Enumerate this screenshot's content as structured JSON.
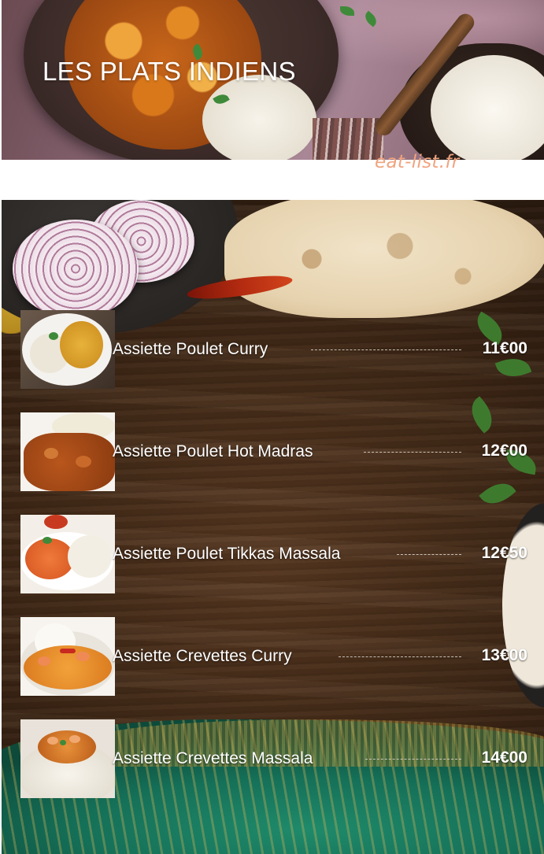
{
  "header": {
    "title": "LES PLATS INDIENS",
    "watermark": "eat-list.fr"
  },
  "menu": {
    "items": [
      {
        "name": "Assiette Poulet Curry",
        "price": "11€00"
      },
      {
        "name": "Assiette Poulet Hot Madras",
        "price": "12€00"
      },
      {
        "name": "Assiette Poulet Tikkas Massala",
        "price": "12€50"
      },
      {
        "name": "Assiette Crevettes Curry",
        "price": "13€00"
      },
      {
        "name": "Assiette Crevettes Massala",
        "price": "14€00"
      }
    ]
  },
  "colors": {
    "title_text": "#ffffff",
    "watermark": "#f1a37e",
    "item_text": "#ffffff",
    "board_wood": "#432a17",
    "sari_green": "#157058"
  }
}
